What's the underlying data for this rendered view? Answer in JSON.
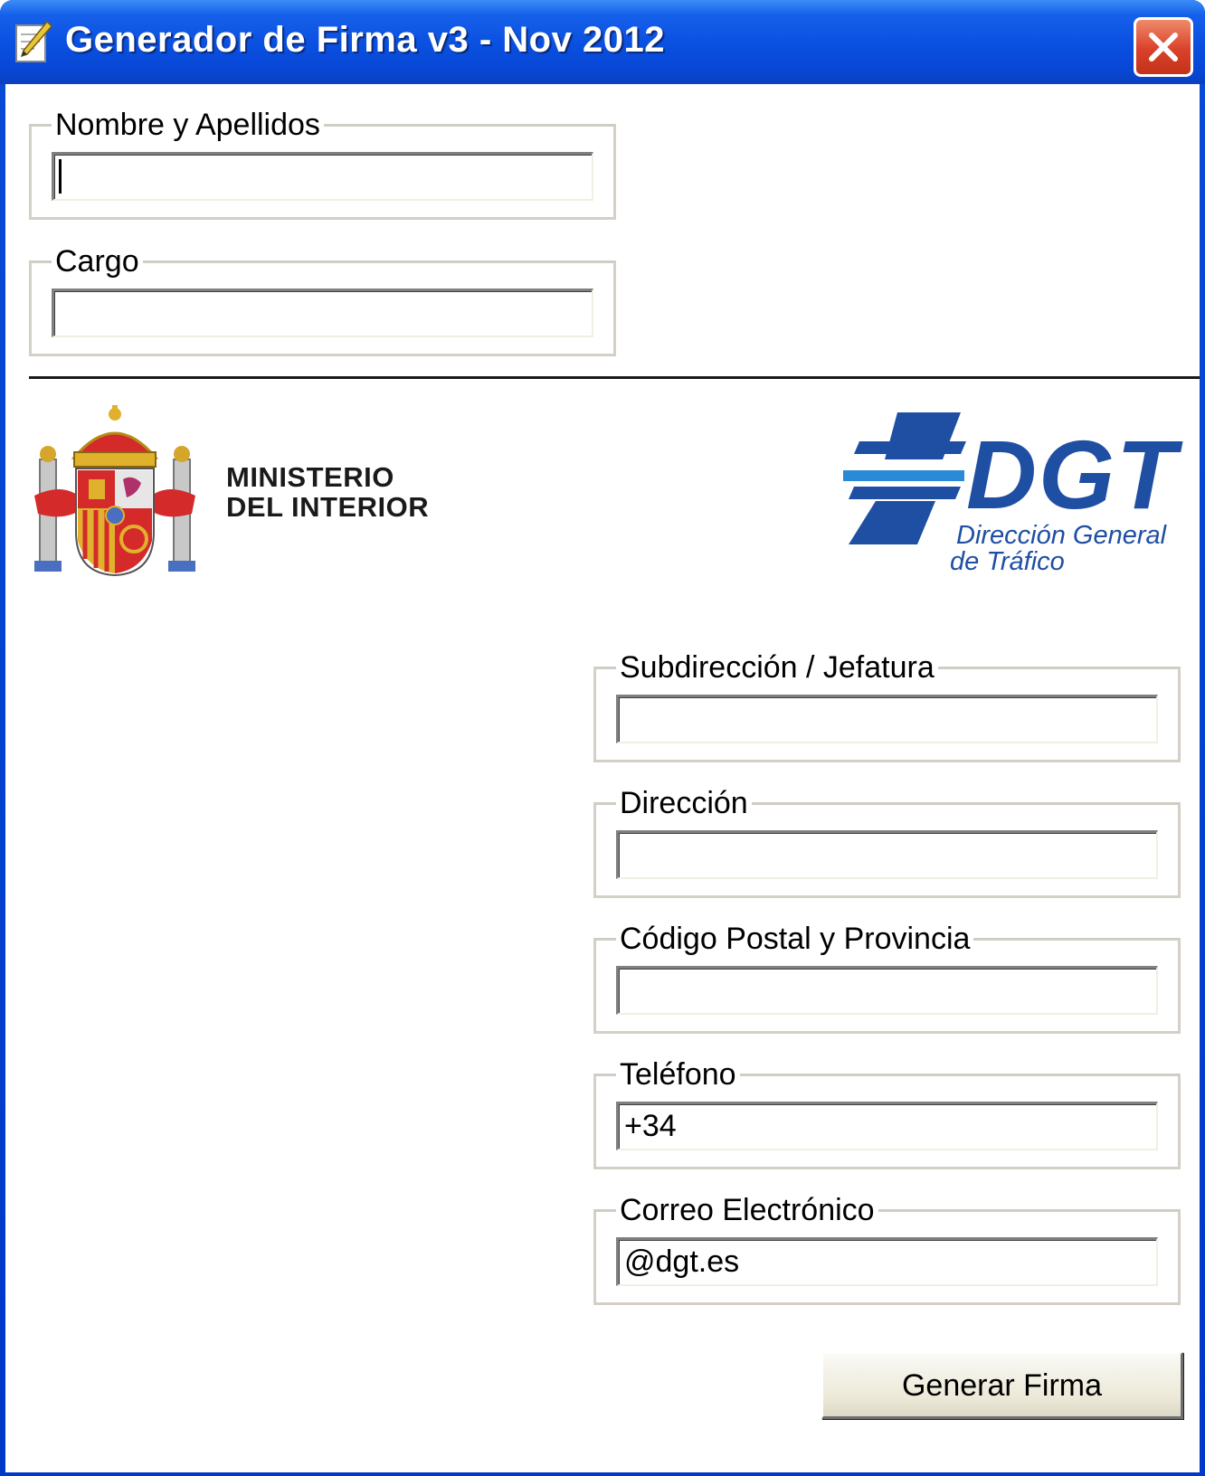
{
  "window": {
    "title": "Generador de Firma v3 - Nov 2012",
    "app_icon": "pen-paper-icon",
    "close_icon": "close-icon"
  },
  "form_top": {
    "nombre": {
      "label": "Nombre y Apellidos",
      "value": ""
    },
    "cargo": {
      "label": "Cargo",
      "value": ""
    }
  },
  "logos": {
    "ministry_line1": "MINISTERIO",
    "ministry_line2": "DEL INTERIOR",
    "ministry_emblem": "coat-of-arms-of-spain",
    "dgt_mark": "DGT",
    "dgt_line1": "Dirección General",
    "dgt_line2": "de Tráfico"
  },
  "form_right": {
    "subdireccion": {
      "label": "Subdirección / Jefatura",
      "value": ""
    },
    "direccion": {
      "label": "Dirección",
      "value": ""
    },
    "codigo_postal": {
      "label": "Código Postal y Provincia",
      "value": ""
    },
    "telefono": {
      "label": "Teléfono",
      "value": "+34"
    },
    "correo": {
      "label": "Correo Electrónico",
      "value": "@dgt.es"
    }
  },
  "actions": {
    "generate_label": "Generar Firma"
  },
  "colors": {
    "titlebar": "#0a4fe0",
    "close_button": "#d9412a",
    "dgt_blue": "#1f4fa3",
    "dgt_light_blue": "#2a8ad6"
  }
}
